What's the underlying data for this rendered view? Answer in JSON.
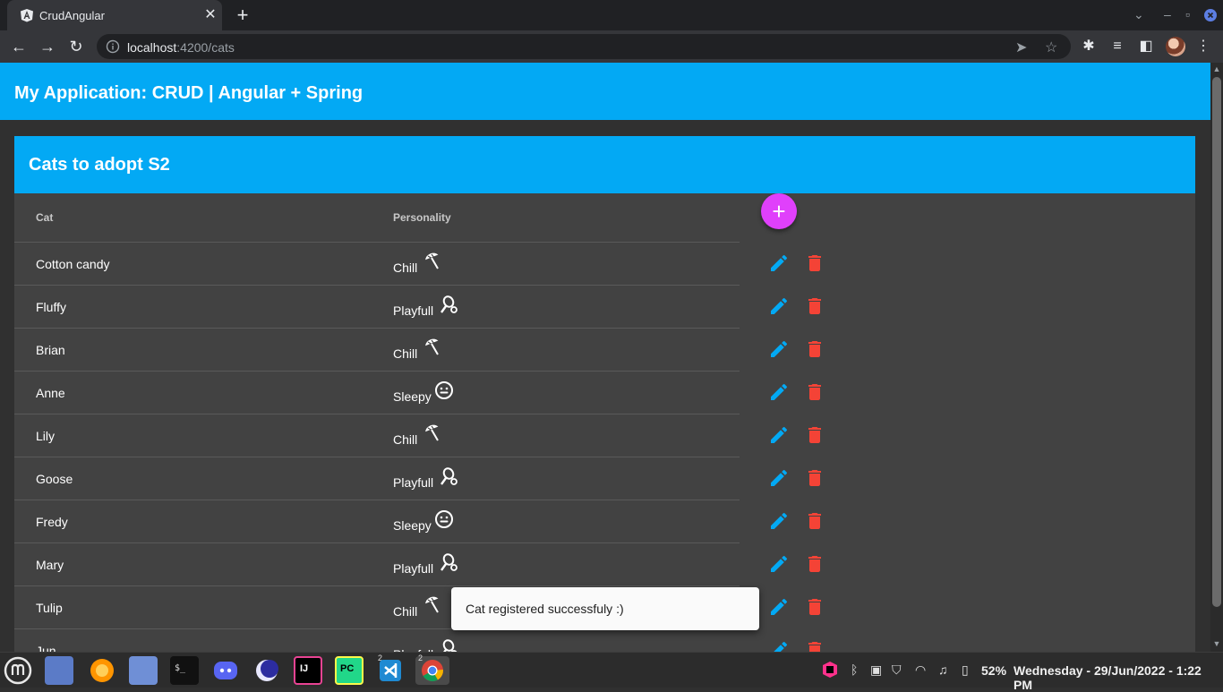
{
  "browser": {
    "tab_title": "CrudAngular",
    "url_host": "localhost",
    "url_path": ":4200/cats"
  },
  "app": {
    "title": "My Application: CRUD | Angular + Spring"
  },
  "card": {
    "title": "Cats to adopt S2",
    "columns": [
      "Cat",
      "Personality"
    ],
    "add_label": "+"
  },
  "cats": [
    {
      "name": "Cotton candy",
      "personality": "Chill",
      "icon": "umbrella-beach-icon"
    },
    {
      "name": "Fluffy",
      "personality": "Playfull",
      "icon": "badminton-icon"
    },
    {
      "name": "Brian",
      "personality": "Chill",
      "icon": "umbrella-beach-icon"
    },
    {
      "name": "Anne",
      "personality": "Sleepy",
      "icon": "smiley-icon"
    },
    {
      "name": "Lily",
      "personality": "Chill",
      "icon": "umbrella-beach-icon"
    },
    {
      "name": "Goose",
      "personality": "Playfull",
      "icon": "badminton-icon"
    },
    {
      "name": "Fredy",
      "personality": "Sleepy",
      "icon": "smiley-icon"
    },
    {
      "name": "Mary",
      "personality": "Playfull",
      "icon": "badminton-icon"
    },
    {
      "name": "Tulip",
      "personality": "Chill",
      "icon": "umbrella-beach-icon"
    },
    {
      "name": "Jun",
      "personality": "Playfull",
      "icon": "badminton-icon"
    }
  ],
  "snackbar": {
    "message": "Cat registered successfuly :)"
  },
  "taskbar": {
    "battery": "52%",
    "clock": "Wednesday - 29/Jun/2022 -  1:22 PM",
    "badges": [
      "2",
      "2"
    ]
  },
  "colors": {
    "primary": "#03a9f4",
    "accent": "#e040fb",
    "warn": "#f44336",
    "card_bg": "#424242",
    "page_bg": "#303030"
  }
}
